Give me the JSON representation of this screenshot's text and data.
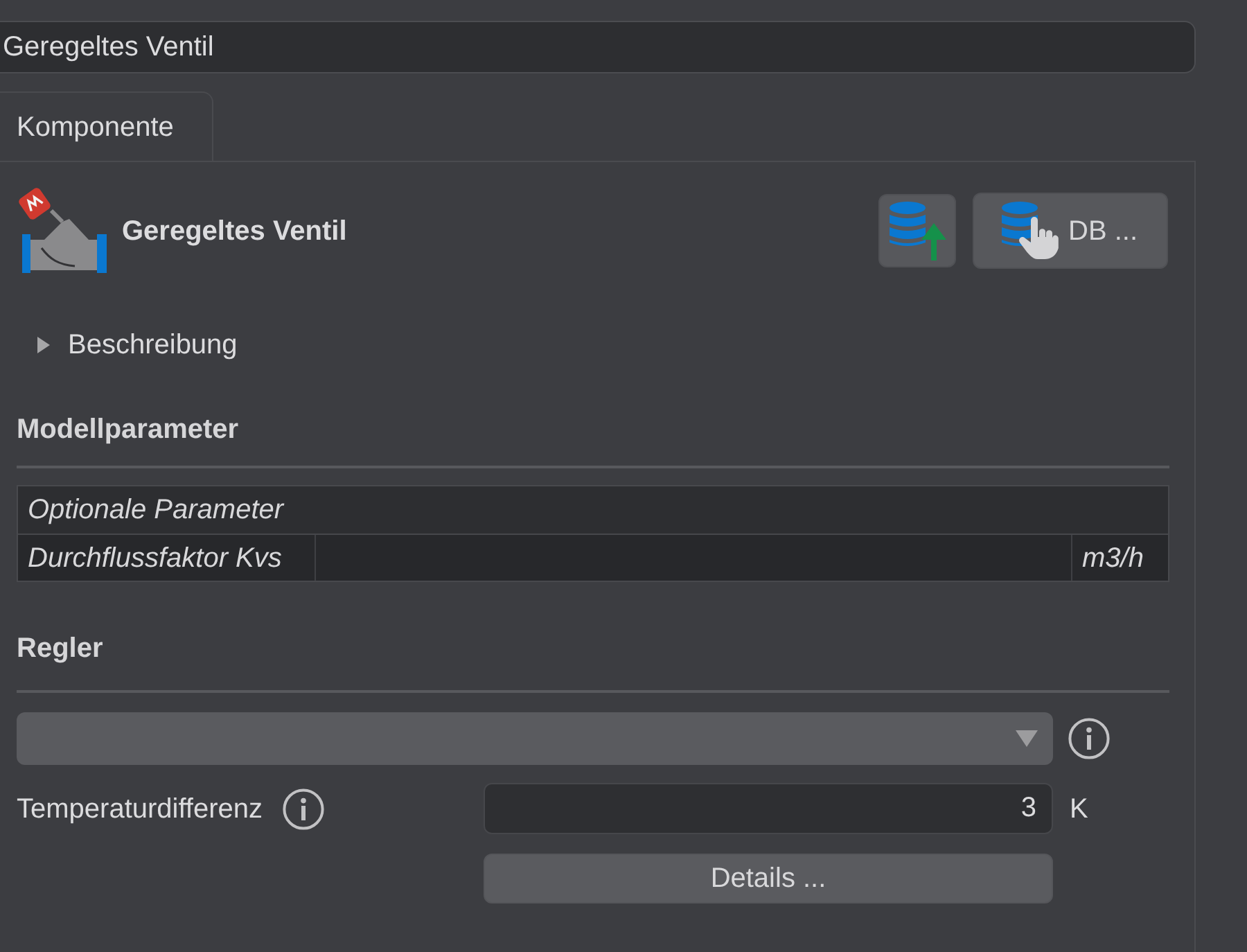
{
  "name_field": {
    "value": "Geregeltes Ventil"
  },
  "tabs": [
    {
      "label": "Komponente",
      "selected": true
    }
  ],
  "component": {
    "title": "Geregeltes Ventil",
    "buttons": [
      {
        "kind": "upload"
      },
      {
        "kind": "select",
        "label": "DB ..."
      }
    ]
  },
  "description": {
    "label": "Beschreibung",
    "expanded": false
  },
  "model_parameters": {
    "heading": "Modellparameter",
    "rows": [
      {
        "kind": "group",
        "label": "Optionale Parameter"
      },
      {
        "kind": "parameter",
        "label": "Durchflussfaktor Kvs",
        "unit": "m3/h"
      }
    ]
  },
  "controller": {
    "heading": "Regler",
    "fields": [
      {
        "label": "Temperaturdifferenz",
        "value": "3",
        "unit": "K"
      }
    ],
    "details_button": "Details ..."
  }
}
